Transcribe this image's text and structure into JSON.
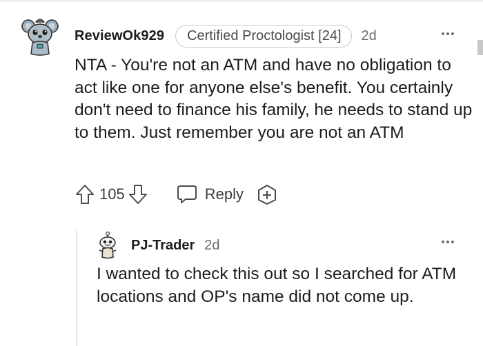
{
  "comment": {
    "username": "ReviewOk929",
    "flair": "Certified Proctologist [24]",
    "age": "2d",
    "body": "NTA - You're not an ATM and have no obligation to act like one for anyone else's benefit. You certainly don't need to finance his family, he needs to stand up to them. Just remember you are not an ATM",
    "score": "105",
    "reply_label": "Reply"
  },
  "reply": {
    "username": "PJ-Trader",
    "age": "2d",
    "body": "I wanted to check this out so I searched for ATM locations and OP's name did not come up."
  },
  "icons": {
    "upvote": "arrow-up-outline",
    "downvote": "arrow-down-outline",
    "reply": "speech-bubble-outline",
    "award": "plus-in-circle-outline",
    "more": "horizontal-ellipsis"
  },
  "colors": {
    "text": "#1c1c1c",
    "muted": "#6a6a6a",
    "flair_border": "#c9c9c9",
    "thread_line": "#e4e4e4"
  }
}
